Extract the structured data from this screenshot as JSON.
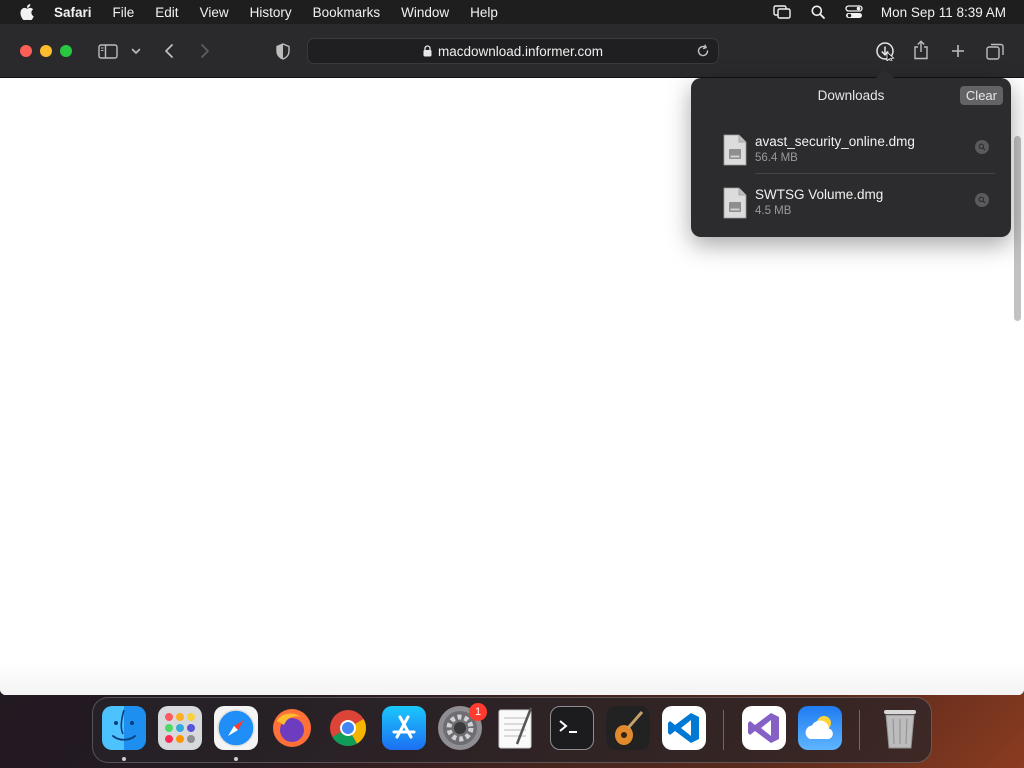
{
  "menubar": {
    "app_name": "Safari",
    "items": [
      "File",
      "Edit",
      "View",
      "History",
      "Bookmarks",
      "Window",
      "Help"
    ],
    "clock": "Mon Sep 11  8:39 AM",
    "status_icons": [
      "screen-mirroring-icon",
      "spotlight-search-icon",
      "control-center-icon"
    ]
  },
  "toolbar": {
    "url": "macdownload.informer.com"
  },
  "downloads": {
    "title": "Downloads",
    "clear_label": "Clear",
    "items": [
      {
        "name": "avast_security_online.dmg",
        "size": "56.4 MB"
      },
      {
        "name": "SWTSG Volume.dmg",
        "size": "4.5 MB"
      }
    ]
  },
  "dock": {
    "apps": [
      "Finder",
      "Launchpad",
      "Safari",
      "Firefox",
      "Google Chrome",
      "App Store",
      "System Settings",
      "TextEdit",
      "Terminal",
      "GarageBand",
      "Visual Studio Code",
      "Visual Studio",
      "Weather",
      "Trash"
    ],
    "system_settings_badge": "1",
    "colors": {
      "badge": "#ff3b30",
      "accent": "#0a84ff"
    }
  }
}
